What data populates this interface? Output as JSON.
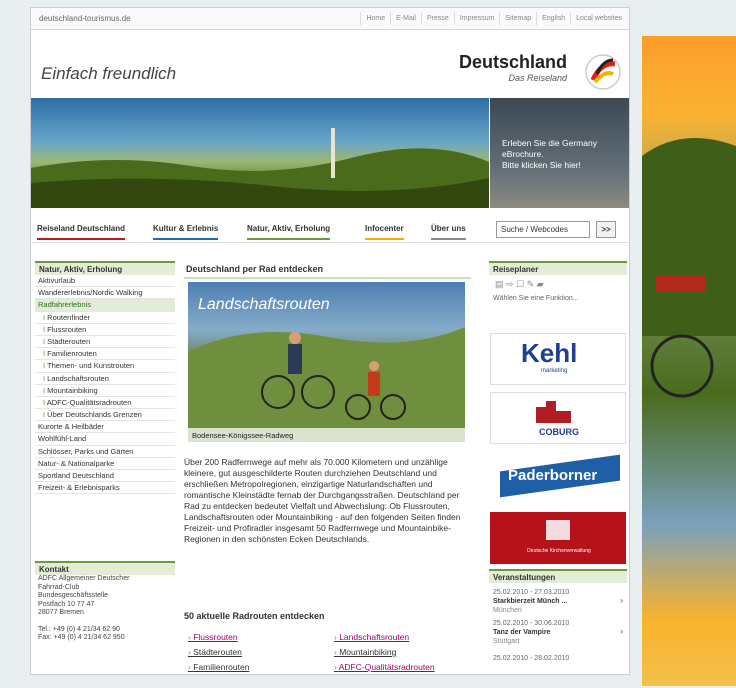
{
  "topbar": {
    "domain": "deutschland-tourismus.de",
    "links": [
      "Home",
      "E-Mail",
      "Presse",
      "Impressum",
      "Sitemap",
      "English",
      "Local websites"
    ]
  },
  "header": {
    "slogan": "Einfach freundlich",
    "brand_name": "Deutschland",
    "brand_sub": "Das Reiseland"
  },
  "promo": {
    "line1": "Erleben Sie die Germany",
    "line2": "eBrochure.",
    "line3": "Bitte klicken Sie hier!"
  },
  "mainnav": {
    "items": [
      "Reiseland Deutschland",
      "Kultur & Erlebnis",
      "Natur, Aktiv, Erholung",
      "Infocenter",
      "Über uns"
    ],
    "search_value": "Suche / Webcodes",
    "search_btn": ">>"
  },
  "leftnav": {
    "title": "Natur, Aktiv, Erholung",
    "items": [
      "Aktivurlaub",
      "Wandererlebnis/Nordic Walking",
      "Radfahrerlebnis",
      "Routenfinder",
      "Flussrouten",
      "Städterouten",
      "Familienrouten",
      "Themen- und Kunstrouten",
      "Landschaftsrouten",
      "Mountainbiking",
      "ADFC-Qualitätsradrouten",
      "Über Deutschlands Grenzen",
      "Kurorte & Heilbäder",
      "Wohlfühl-Land",
      "Schlösser, Parks und Gärten",
      "Natur- & Nationalparke",
      "Sportland Deutschland",
      "Freizeit- & Erlebnisparks"
    ]
  },
  "contact": {
    "title": "Kontakt",
    "lines": [
      "ADFC Allgemeiner Deutscher",
      "Fahrrad-Club",
      "Bundesgeschäftsstelle",
      "Postfach 10 77 47",
      "28077 Bremen",
      "",
      "Tel.: +49 (0) 4 21/34 62 90",
      "Fax: +49 (0) 4 21/34 62 950"
    ]
  },
  "center": {
    "title": "Deutschland per Rad entdecken",
    "img_title": "Landschaftsrouten",
    "img_caption": "Bodensee-Königssee-Radweg",
    "body": "Über 200 Radfernwege auf mehr als 70.000 Kilometern und unzählige kleinere, gut ausgeschilderte Routen durchziehen Deutschland und erschließen Metropolregionen, einzigartige Naturlandschaften und romantische Kleinstädte fernab der Durchgangsstraßen. Deutschland per Rad zu entdecken bedeutet Vielfalt und Abwechslung: Ob Flussrouten, Landschaftsrouten oder Mountainbiking - auf den folgenden Seiten finden Freizeit- und Profiradler insgesamt 50 Radfernwege und Mountainbike-Regionen in den schönsten Ecken Deutschlands.",
    "routes_title": "50 aktuelle Radrouten entdecken",
    "routes_left": [
      "Flussrouten",
      "Städterouten",
      "Familienrouten"
    ],
    "routes_right": [
      "Landschaftsrouten",
      "Mountainbiking",
      "ADFC-Qualitätsradrouten"
    ]
  },
  "right": {
    "planer_title": "Reiseplaner",
    "planer_text": "Wählen Sie eine Funktion...",
    "ads": [
      "Kehl",
      "marketing",
      "COBURG",
      "Paderborner",
      "Deutsche Kirchenverwaltung"
    ],
    "events_title": "Veranstaltungen",
    "events": [
      {
        "date": "25.02.2010 - 27.03.2010",
        "title": "Starkbierzeit Münch ...",
        "loc": "München"
      },
      {
        "date": "25.02.2010 - 30.06.2010",
        "title": "Tanz der Vampire",
        "loc": "Stuttgart"
      },
      {
        "date": "25.02.2010 - 28.02.2010",
        "title": "",
        "loc": ""
      }
    ]
  },
  "colors": {
    "accent_green": "#6c9a3a",
    "link_purple": "#a0006a",
    "nav_green": "#2d6e1f"
  }
}
